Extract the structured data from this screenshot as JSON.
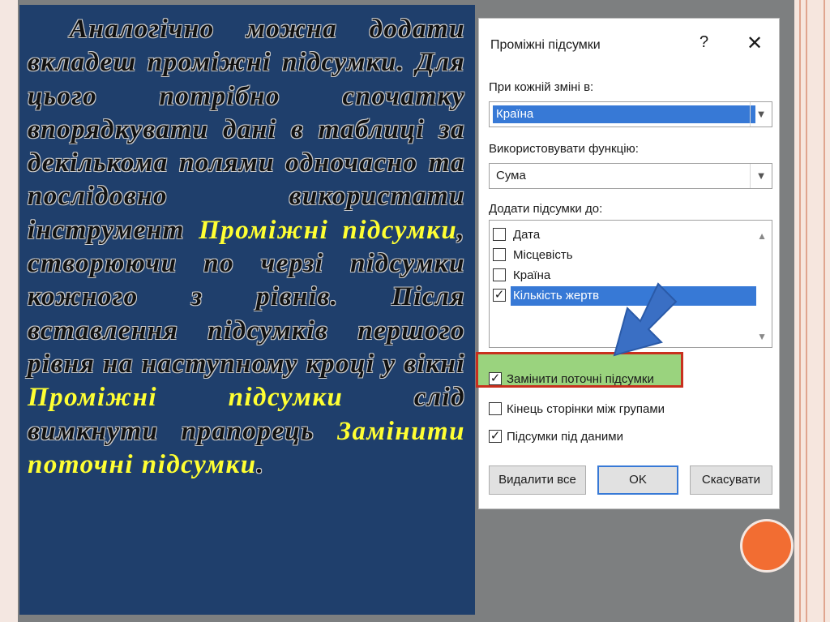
{
  "slide_text": {
    "part1": "Аналогічно можна додати вкладеш проміжні підсумки. Для цього потрібно спочатку впорядкувати дані в таблиці за декількома полями одночасно та послідовно використати інструмент ",
    "hl1": "Проміжні підсумки",
    "part2": ", створюючи по черзі підсумки кожного з рівнів. Після вставлення підсумків першого рівня на наступному кроці у вікні ",
    "hl2": "Проміжні підсумки",
    "part3": " слід вимкнути прапорець ",
    "hl3": "Замінити поточні підсумки",
    "part4": "."
  },
  "dialog": {
    "title": "Проміжні підсумки",
    "help": "?",
    "close": "✕",
    "group_label": "При кожній зміні в:",
    "group_value": "Країна",
    "function_label": "Використовувати функцію:",
    "function_value": "Сума",
    "add_to_label": "Додати підсумки до:",
    "columns": [
      {
        "label": "Дата",
        "checked": false
      },
      {
        "label": "Місцевість",
        "checked": false
      },
      {
        "label": "Країна",
        "checked": false
      },
      {
        "label": "Кількість жертв",
        "checked": true
      }
    ],
    "replace_current": "Замінити поточні підсумки",
    "page_break": "Кінець сторінки між групами",
    "summary_below": "Підсумки під даними",
    "remove_all": "Видалити все",
    "ok": "OK",
    "cancel": "Скасувати",
    "check_mark": "✓"
  },
  "colors": {
    "text_panel": "#1f3f6c",
    "highlight_text": "#ffff33",
    "selection": "#3779d6",
    "callout_border": "#c8301e",
    "callout_fill": "#9ad37e",
    "arrow": "#3a6fc4",
    "orange_dot": "#f26d32"
  }
}
